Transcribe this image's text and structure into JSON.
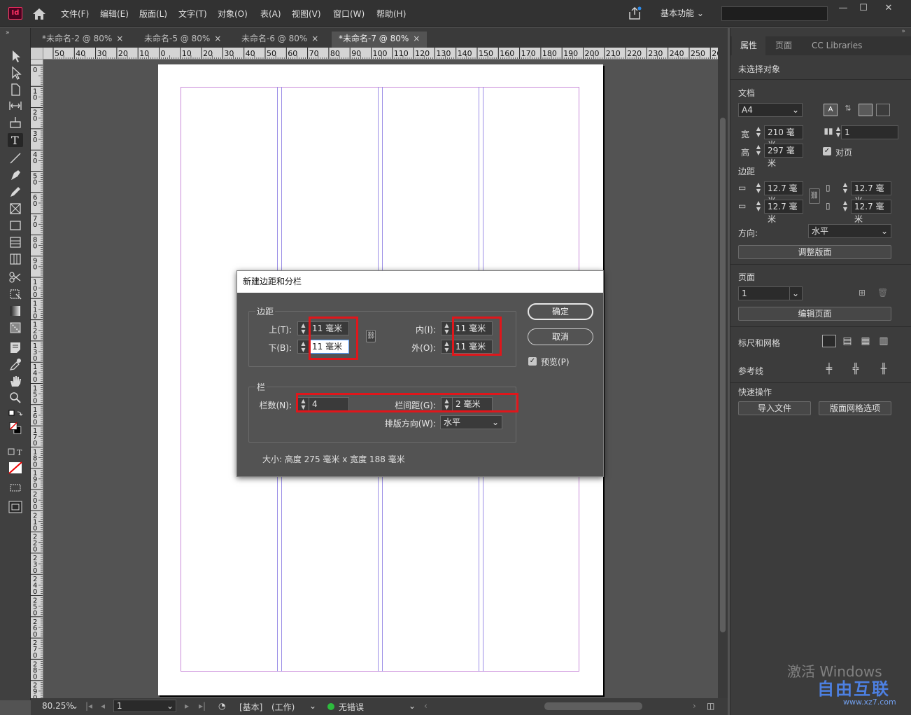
{
  "menubar": {
    "app_icon": "Id",
    "items": [
      "文件(F)",
      "编辑(E)",
      "版面(L)",
      "文字(T)",
      "对象(O)",
      "表(A)",
      "视图(V)",
      "窗口(W)",
      "帮助(H)"
    ],
    "workspace": "基本功能",
    "search_placeholder": ""
  },
  "tabs": [
    {
      "label": "*未命名-2 @ 80%",
      "active": false
    },
    {
      "label": "未命名-5 @ 80%",
      "active": false
    },
    {
      "label": "未命名-6 @ 80%",
      "active": false
    },
    {
      "label": "*未命名-7 @ 80%",
      "active": true
    }
  ],
  "ruler": {
    "top_labels": [
      "50",
      "40",
      "30",
      "20",
      "10",
      "0",
      "10",
      "20",
      "30",
      "40",
      "50",
      "60",
      "70",
      "80",
      "90",
      "100",
      "110",
      "120",
      "130",
      "140",
      "150",
      "160",
      "170",
      "180",
      "190",
      "200",
      "210",
      "220",
      "230",
      "240",
      "250",
      "26"
    ],
    "left_labels": [
      "0",
      "1\n0",
      "2\n0",
      "3\n0",
      "4\n0",
      "5\n0",
      "6\n0",
      "7\n0",
      "8\n0",
      "9\n0",
      "1\n0\n0",
      "1\n1\n0",
      "1\n2\n0",
      "1\n3\n0",
      "1\n4\n0",
      "1\n5\n0",
      "1\n6\n0",
      "1\n7\n0",
      "1\n8\n0",
      "1\n9\n0",
      "2\n0\n0",
      "2\n1\n0",
      "2\n2\n0",
      "2\n3\n0",
      "2\n4\n0",
      "2\n5\n0",
      "2\n6\n0",
      "2\n7\n0",
      "2\n8\n0",
      "2\n9\n0"
    ]
  },
  "dialog": {
    "title": "新建边距和分栏",
    "margins_group": "边距",
    "top_label": "上(T):",
    "top_value": "11 毫米",
    "bottom_label": "下(B):",
    "bottom_value": "11 毫米",
    "inside_label": "内(I):",
    "inside_value": "11 毫米",
    "outside_label": "外(O):",
    "outside_value": "11 毫米",
    "columns_group": "栏",
    "columns_label": "栏数(N):",
    "columns_value": "4",
    "gutter_label": "栏间距(G):",
    "gutter_value": "2 毫米",
    "direction_label": "排版方向(W):",
    "direction_value": "水平",
    "size_text": "大小: 高度 275 毫米 x 宽度 188 毫米",
    "ok": "确定",
    "cancel": "取消",
    "preview": "预览(P)",
    "preview_checked": true
  },
  "panel": {
    "tabs": [
      "属性",
      "页面",
      "CC Libraries"
    ],
    "no_selection": "未选择对象",
    "doc_section": "文档",
    "page_size": "A4",
    "width_label": "宽",
    "width_value": "210 毫米",
    "height_label": "高",
    "height_value": "297 毫米",
    "pages_value": "1",
    "facing_pages": "对页",
    "margins_section": "边距",
    "margin_values": [
      "12.7 毫米",
      "12.7 毫米",
      "12.7 毫米",
      "12.7 毫米"
    ],
    "orientation_label": "方向:",
    "orientation_value": "水平",
    "adjust_layout": "调整版面",
    "page_section": "页面",
    "page_value": "1",
    "edit_page": "编辑页面",
    "rulers_grids": "标尺和网格",
    "guides": "参考线",
    "quick_actions": "快速操作",
    "import_file": "导入文件",
    "layout_grid": "版面网格选项"
  },
  "status": {
    "zoom": "80.25%",
    "page": "1",
    "master": "[基本]",
    "state": "(工作)",
    "preflight": "无错误",
    "preflight_color": "#2dbb3d"
  },
  "watermark": {
    "windows": "激活 Windows",
    "logo": "自由互联",
    "url": "www.xz7.com"
  }
}
